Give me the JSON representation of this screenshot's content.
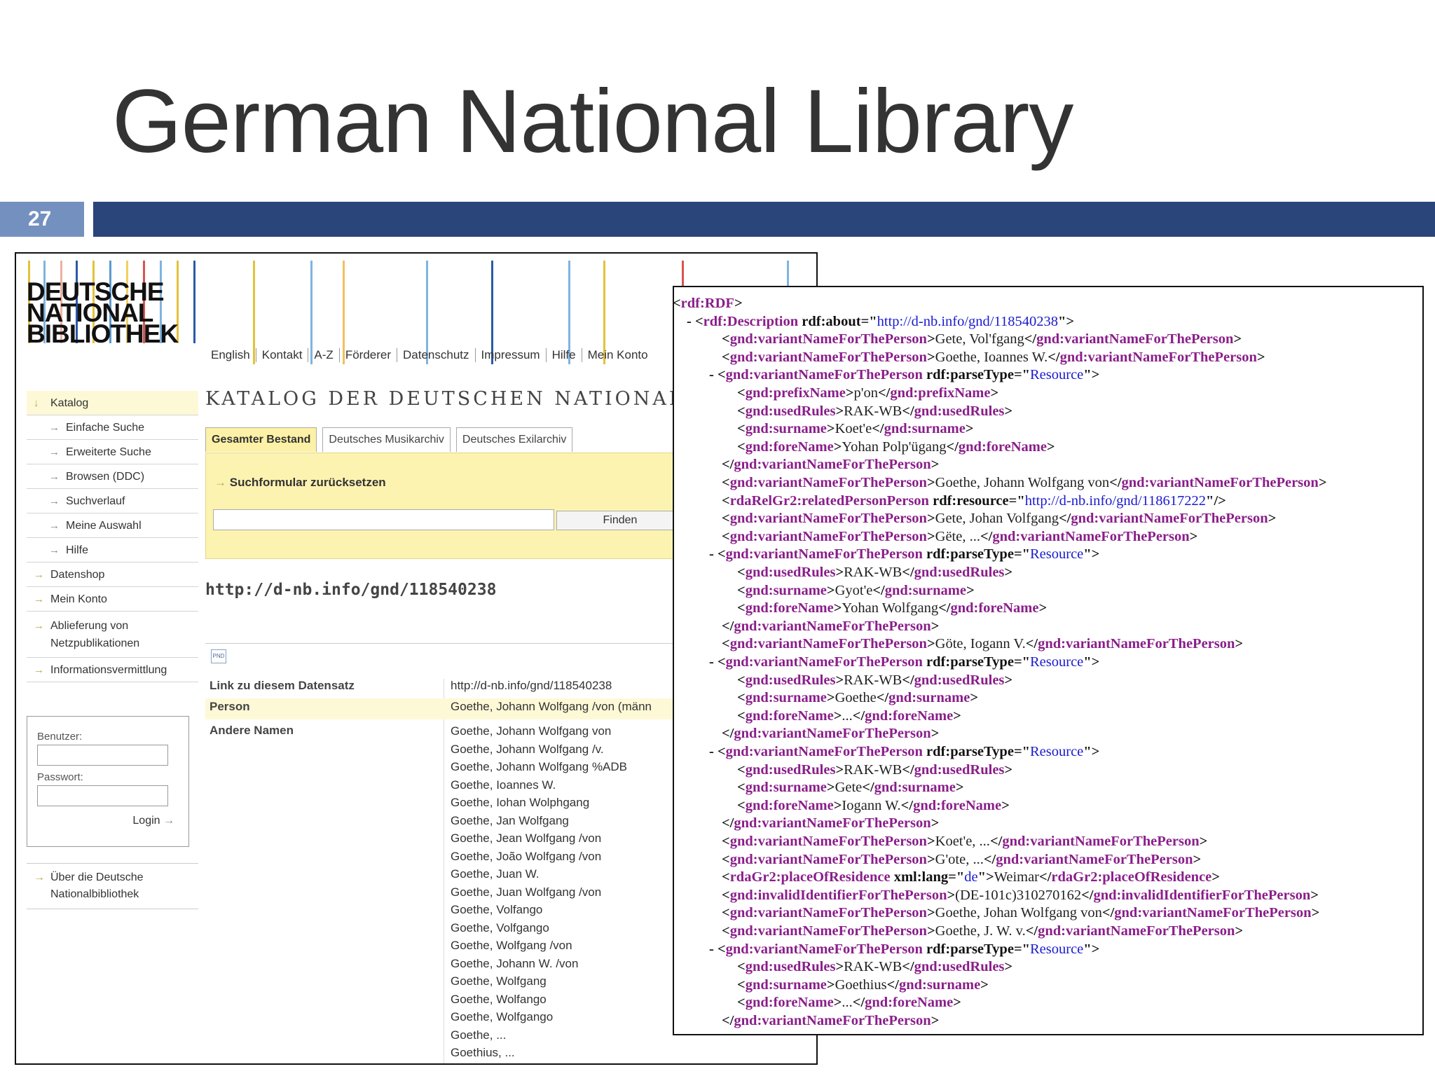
{
  "slide": {
    "title": "German National Library",
    "page_number": "27",
    "colors": {
      "bar": "#2a4579",
      "badge": "#7390bf"
    }
  },
  "library_site": {
    "logo_lines": [
      "DEUTSCHE",
      "NATIONAL",
      "BIBLIOTHEK"
    ],
    "top_nav": [
      "English",
      "Kontakt",
      "A-Z",
      "Förderer",
      "Datenschutz",
      "Impressum",
      "Hilfe",
      "Mein Konto"
    ],
    "sidebar": [
      {
        "label": "Katalog",
        "level": 0,
        "active": true
      },
      {
        "label": "Einfache Suche",
        "level": 1
      },
      {
        "label": "Erweiterte Suche",
        "level": 1
      },
      {
        "label": "Browsen (DDC)",
        "level": 1
      },
      {
        "label": "Suchverlauf",
        "level": 1
      },
      {
        "label": "Meine Auswahl",
        "level": 1
      },
      {
        "label": "Hilfe",
        "level": 1
      },
      {
        "label": "Datenshop",
        "level": 0
      },
      {
        "label": "Mein Konto",
        "level": 0
      },
      {
        "label": "Ablieferung von Netzpublikationen",
        "level": 0
      },
      {
        "label": "Informationsvermittlung",
        "level": 0
      }
    ],
    "login": {
      "user_label": "Benutzer:",
      "password_label": "Passwort:",
      "button": "Login"
    },
    "about_link": "Über die Deutsche Nationalbibliothek",
    "catalog_title": "KATALOG DER DEUTSCHEN NATIONALBI",
    "tabs": [
      "Gesamter Bestand",
      "Deutsches Musikarchiv",
      "Deutsches Exilarchiv"
    ],
    "reset_link": "Suchformular zurücksetzen",
    "find_button": "Finden",
    "gnd_url": "http://d-nb.info/gnd/118540238",
    "pnd_icon": "PND",
    "record": {
      "link_label": "Link zu diesem Datensatz",
      "link_value": "http://d-nb.info/gnd/118540238",
      "person_label": "Person",
      "person_value": "Goethe, Johann Wolfgang /von (männ",
      "other_names_label": "Andere Namen",
      "other_names": [
        "Goethe, Johann Wolfgang von",
        "Goethe, Johann Wolfgang /v.",
        "Goethe, Johann Wolfgang %ADB",
        "Goethe, Ioannes W.",
        "Goethe, Iohan Wolphgang",
        "Goethe, Jan Wolfgang",
        "Goethe, Jean Wolfgang /von",
        "Goethe, João Wolfgang /von",
        "Goethe, Juan W.",
        "Goethe, Juan Wolfgang /von",
        "Goethe, Volfango",
        "Goethe, Volfgango",
        "Goethe, Wolfgang /von",
        "Goethe, Johann W. /von",
        "Goethe, Wolfgang",
        "Goethe, Wolfango",
        "Goethe, Wolfgango",
        "Goethe, ...",
        "Goethius, ..."
      ]
    }
  },
  "rdf_xml": [
    {
      "indent": 0,
      "c": "- ",
      "t": "rdf:RDF",
      "open": true
    },
    {
      "indent": 1,
      "c": "- ",
      "t": "rdf:Description",
      "attr": "rdf:about",
      "val": "http://d-nb.info/gnd/118540238",
      "open": true
    },
    {
      "indent": 2,
      "t": "gnd:variantNameForThePerson",
      "text": "Gete, Vol'fgang"
    },
    {
      "indent": 2,
      "t": "gnd:variantNameForThePerson",
      "text": "Goethe, Ioannes W."
    },
    {
      "indent": 2,
      "c": "- ",
      "t": "gnd:variantNameForThePerson",
      "attr": "rdf:parseType",
      "val": "Resource",
      "open": true
    },
    {
      "indent": 3,
      "t": "gnd:prefixName",
      "text": "p'on"
    },
    {
      "indent": 3,
      "t": "gnd:usedRules",
      "text": "RAK-WB"
    },
    {
      "indent": 3,
      "t": "gnd:surname",
      "text": "Koet'e"
    },
    {
      "indent": 3,
      "t": "gnd:foreName",
      "text": "Yohan Polp'ügang"
    },
    {
      "indent": 2,
      "t": "gnd:variantNameForThePerson",
      "close": true
    },
    {
      "indent": 2,
      "t": "gnd:variantNameForThePerson",
      "text": "Goethe, Johann Wolfgang von"
    },
    {
      "indent": 2,
      "t": "rdaRelGr2:relatedPersonPerson",
      "attr": "rdf:resource",
      "val": "http://d-nb.info/gnd/118617222",
      "selfclose": true
    },
    {
      "indent": 2,
      "t": "gnd:variantNameForThePerson",
      "text": "Gete, Johan Volfgang"
    },
    {
      "indent": 2,
      "t": "gnd:variantNameForThePerson",
      "text": "Gëte, ..."
    },
    {
      "indent": 2,
      "c": "- ",
      "t": "gnd:variantNameForThePerson",
      "attr": "rdf:parseType",
      "val": "Resource",
      "open": true
    },
    {
      "indent": 3,
      "t": "gnd:usedRules",
      "text": "RAK-WB"
    },
    {
      "indent": 3,
      "t": "gnd:surname",
      "text": "Gyot'e"
    },
    {
      "indent": 3,
      "t": "gnd:foreName",
      "text": "Yohan Wolfgang"
    },
    {
      "indent": 2,
      "t": "gnd:variantNameForThePerson",
      "close": true
    },
    {
      "indent": 2,
      "t": "gnd:variantNameForThePerson",
      "text": "Göte, Iogann V."
    },
    {
      "indent": 2,
      "c": "- ",
      "t": "gnd:variantNameForThePerson",
      "attr": "rdf:parseType",
      "val": "Resource",
      "open": true
    },
    {
      "indent": 3,
      "t": "gnd:usedRules",
      "text": "RAK-WB"
    },
    {
      "indent": 3,
      "t": "gnd:surname",
      "text": "Goethe"
    },
    {
      "indent": 3,
      "t": "gnd:foreName",
      "text": "..."
    },
    {
      "indent": 2,
      "t": "gnd:variantNameForThePerson",
      "close": true
    },
    {
      "indent": 2,
      "c": "- ",
      "t": "gnd:variantNameForThePerson",
      "attr": "rdf:parseType",
      "val": "Resource",
      "open": true
    },
    {
      "indent": 3,
      "t": "gnd:usedRules",
      "text": "RAK-WB"
    },
    {
      "indent": 3,
      "t": "gnd:surname",
      "text": "Gete"
    },
    {
      "indent": 3,
      "t": "gnd:foreName",
      "text": "Iogann W."
    },
    {
      "indent": 2,
      "t": "gnd:variantNameForThePerson",
      "close": true
    },
    {
      "indent": 2,
      "t": "gnd:variantNameForThePerson",
      "text": "Koet'e, ..."
    },
    {
      "indent": 2,
      "t": "gnd:variantNameForThePerson",
      "text": "G'ote, ..."
    },
    {
      "indent": 2,
      "t": "rdaGr2:placeOfResidence",
      "attr": "xml:lang",
      "val": "de",
      "text": "Weimar"
    },
    {
      "indent": 2,
      "t": "gnd:invalidIdentifierForThePerson",
      "text": "(DE-101c)310270162"
    },
    {
      "indent": 2,
      "t": "gnd:variantNameForThePerson",
      "text": "Goethe, Johan Wolfgang von"
    },
    {
      "indent": 2,
      "t": "gnd:variantNameForThePerson",
      "text": "Goethe, J. W. v."
    },
    {
      "indent": 2,
      "c": "- ",
      "t": "gnd:variantNameForThePerson",
      "attr": "rdf:parseType",
      "val": "Resource",
      "open": true
    },
    {
      "indent": 3,
      "t": "gnd:usedRules",
      "text": "RAK-WB"
    },
    {
      "indent": 3,
      "t": "gnd:surname",
      "text": "Goethius"
    },
    {
      "indent": 3,
      "t": "gnd:foreName",
      "text": "..."
    },
    {
      "indent": 2,
      "t": "gnd:variantNameForThePerson",
      "close": true
    }
  ]
}
